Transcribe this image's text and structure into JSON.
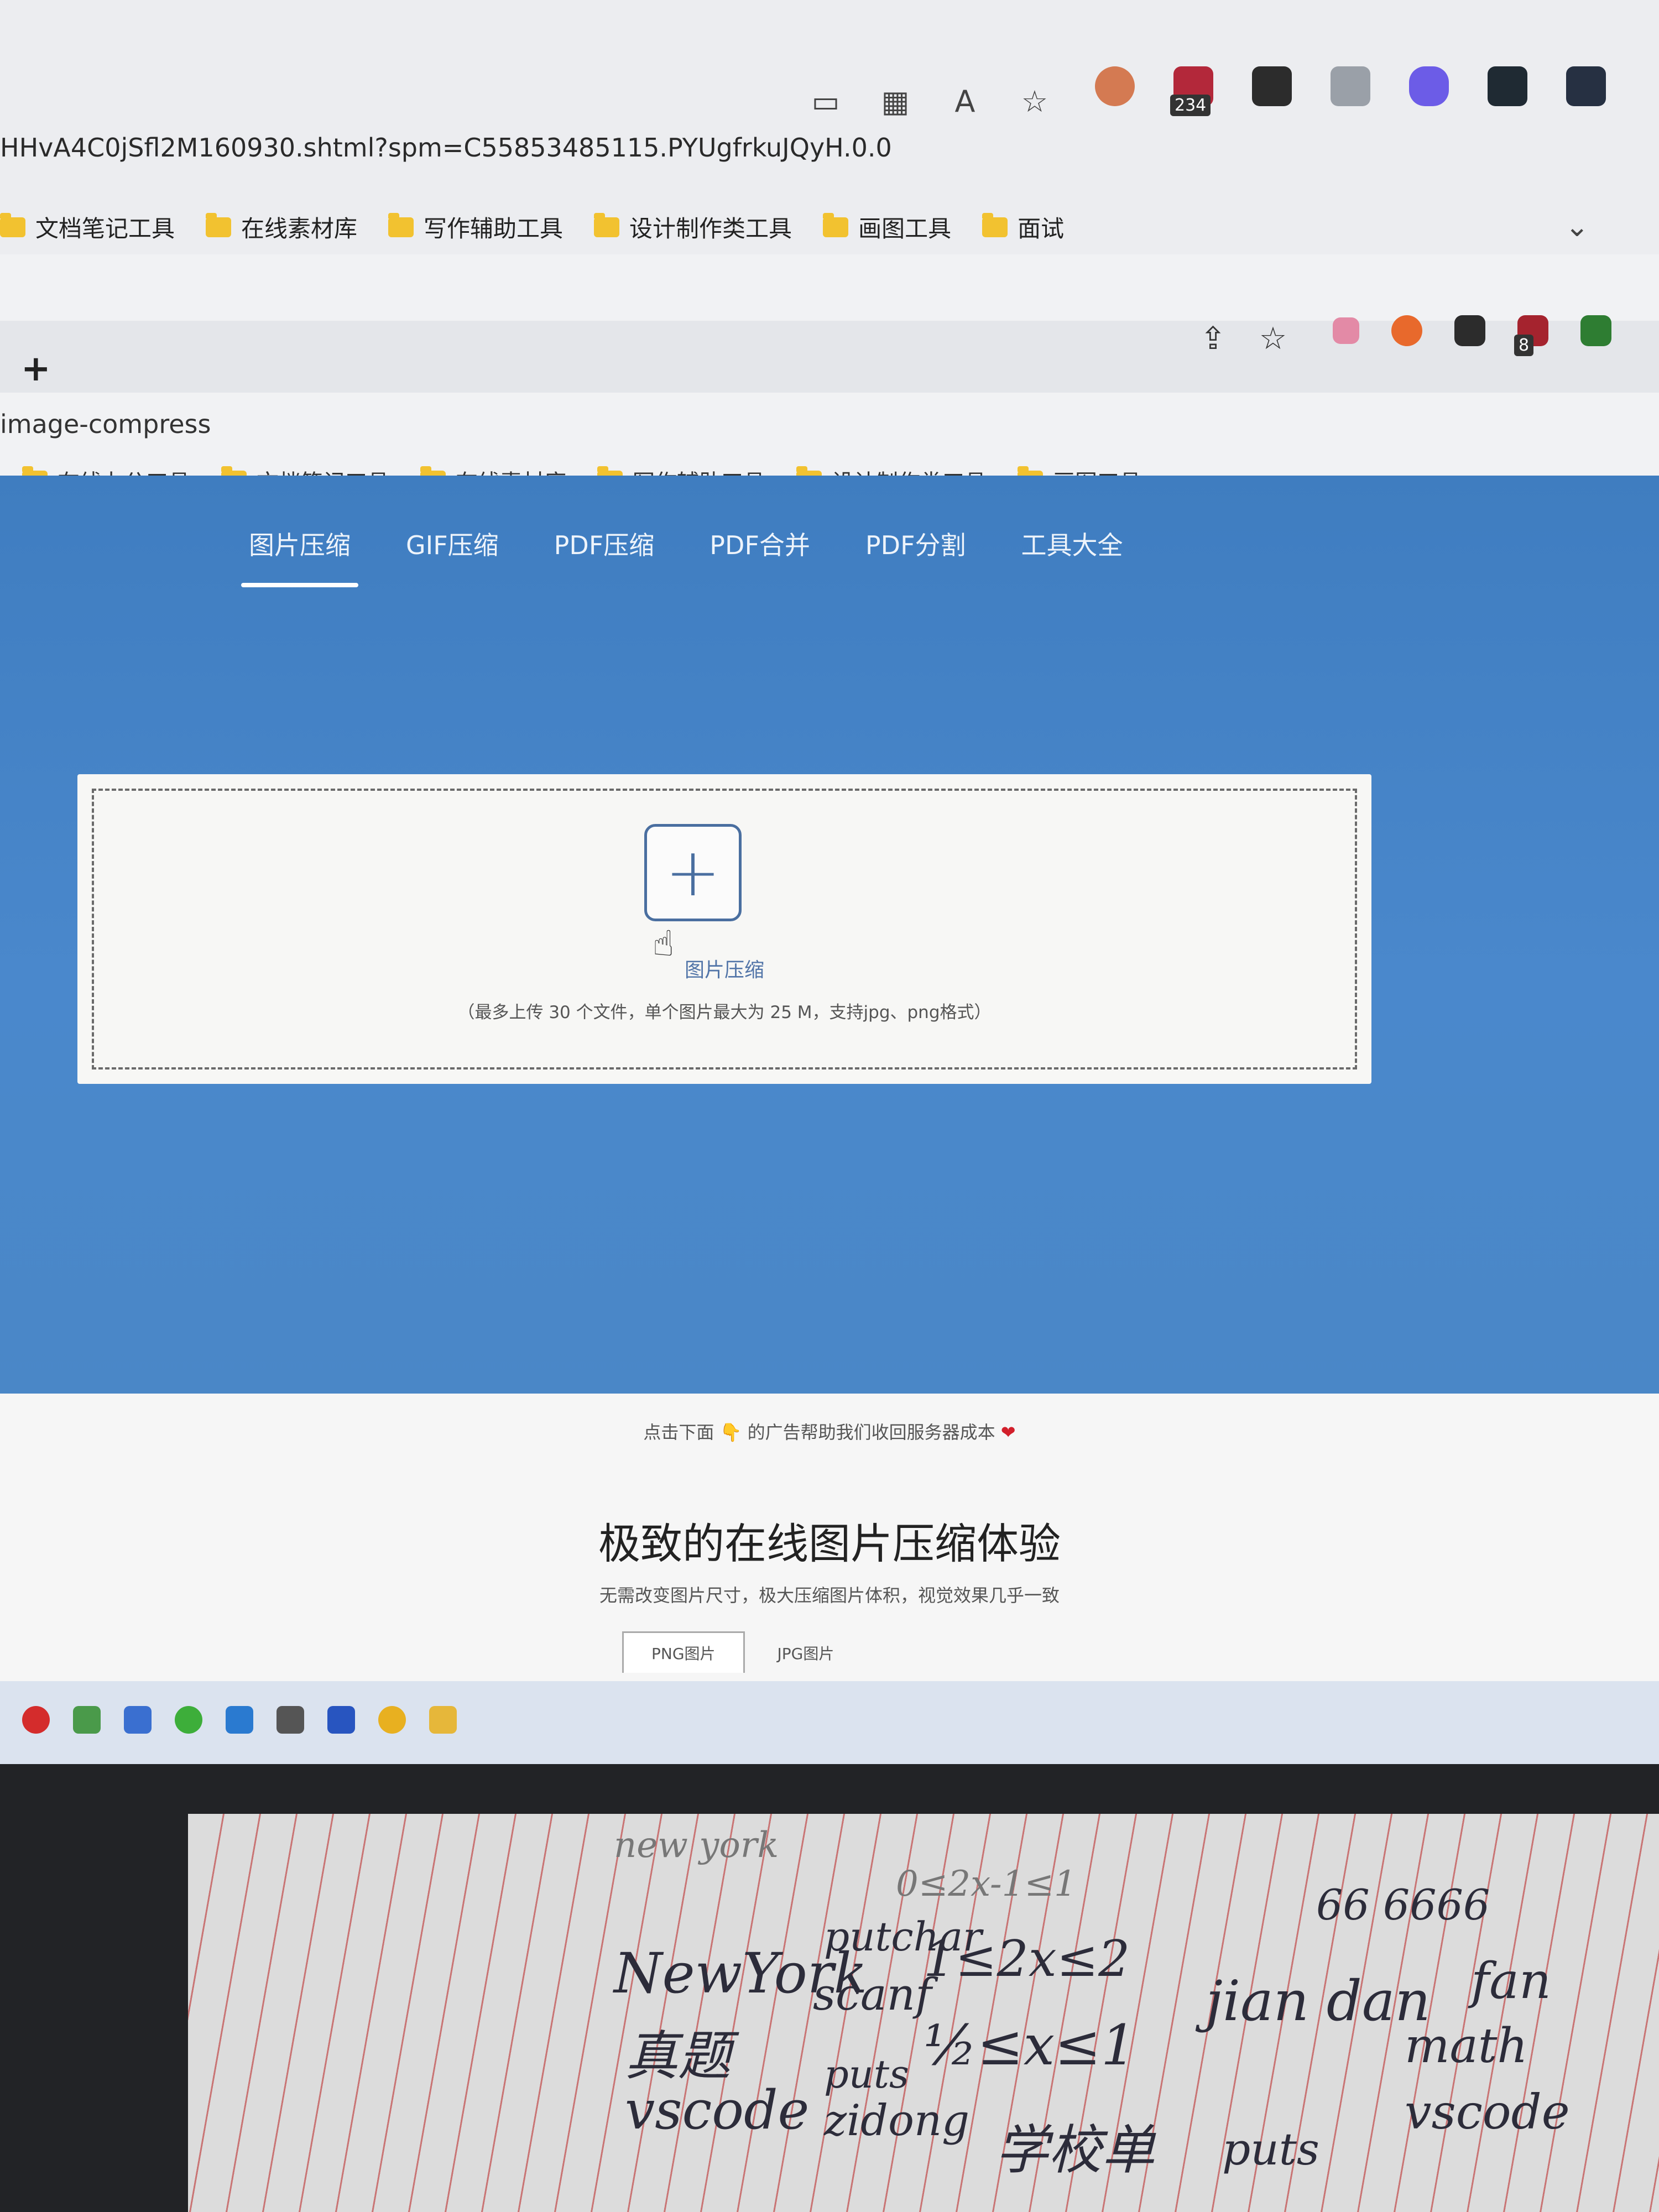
{
  "outer_browser": {
    "address": "HHvA4C0jSfl2M160930.shtml?spm=C55853485115.PYUgfrkuJQyH.0.0",
    "extension_badge": "234",
    "bookmarks": [
      "文档笔记工具",
      "在线素材库",
      "写作辅助工具",
      "设计制作类工具",
      "画图工具",
      "面试"
    ]
  },
  "inner_browser": {
    "new_tab": "+",
    "address": "image-compress",
    "extension_badge": "8",
    "bookmarks": [
      "在线办公工具",
      "文档笔记工具",
      "在线素材库",
      "写作辅助工具",
      "设计制作类工具",
      "画图工具"
    ]
  },
  "site": {
    "nav": [
      "图片压缩",
      "GIF压缩",
      "PDF压缩",
      "PDF合并",
      "PDF分割",
      "工具大全"
    ],
    "active_nav": "图片压缩",
    "upload": {
      "label": "图片压缩",
      "hint": "（最多上传 30 个文件，单个图片最大为 25 M，支持jpg、png格式）"
    },
    "ad_note_before": "点击下面",
    "ad_note_after": "的广告帮助我们收回服务器成本",
    "title": "极致的在线图片压缩体验",
    "subtitle": "无需改变图片尺寸，极大压缩图片体积，视觉效果几乎一致",
    "format_tabs": [
      "PNG图片",
      "JPG图片"
    ]
  },
  "notebook": {
    "lines": [
      "new york",
      "NewYork",
      "putchar",
      "scanf",
      "0≤2x-1≤1",
      "1≤2x≤2",
      "½≤x≤1",
      "真题",
      "vscode",
      "puts",
      "zidong",
      "学校单",
      "jian dan",
      "fan",
      "66 6666",
      "math",
      "vscode",
      "puts"
    ]
  },
  "colors": {
    "hero_blue": "#4a88cc",
    "link_blue": "#5275a8",
    "heart_red": "#d21f2b"
  }
}
